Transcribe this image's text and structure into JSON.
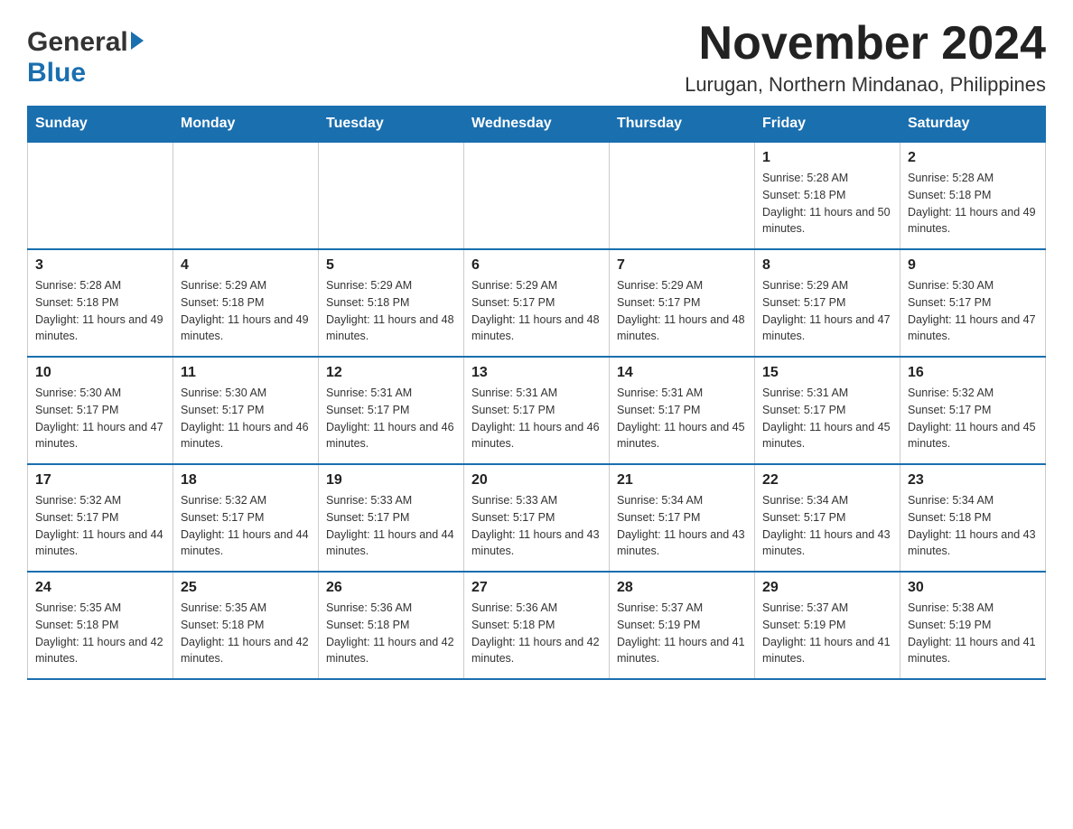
{
  "header": {
    "logo_line1": "General",
    "logo_line2": "Blue",
    "title": "November 2024",
    "subtitle": "Lurugan, Northern Mindanao, Philippines"
  },
  "days_of_week": [
    "Sunday",
    "Monday",
    "Tuesday",
    "Wednesday",
    "Thursday",
    "Friday",
    "Saturday"
  ],
  "weeks": [
    {
      "days": [
        {
          "num": "",
          "sunrise": "",
          "sunset": "",
          "daylight": ""
        },
        {
          "num": "",
          "sunrise": "",
          "sunset": "",
          "daylight": ""
        },
        {
          "num": "",
          "sunrise": "",
          "sunset": "",
          "daylight": ""
        },
        {
          "num": "",
          "sunrise": "",
          "sunset": "",
          "daylight": ""
        },
        {
          "num": "",
          "sunrise": "",
          "sunset": "",
          "daylight": ""
        },
        {
          "num": "1",
          "sunrise": "Sunrise: 5:28 AM",
          "sunset": "Sunset: 5:18 PM",
          "daylight": "Daylight: 11 hours and 50 minutes."
        },
        {
          "num": "2",
          "sunrise": "Sunrise: 5:28 AM",
          "sunset": "Sunset: 5:18 PM",
          "daylight": "Daylight: 11 hours and 49 minutes."
        }
      ]
    },
    {
      "days": [
        {
          "num": "3",
          "sunrise": "Sunrise: 5:28 AM",
          "sunset": "Sunset: 5:18 PM",
          "daylight": "Daylight: 11 hours and 49 minutes."
        },
        {
          "num": "4",
          "sunrise": "Sunrise: 5:29 AM",
          "sunset": "Sunset: 5:18 PM",
          "daylight": "Daylight: 11 hours and 49 minutes."
        },
        {
          "num": "5",
          "sunrise": "Sunrise: 5:29 AM",
          "sunset": "Sunset: 5:18 PM",
          "daylight": "Daylight: 11 hours and 48 minutes."
        },
        {
          "num": "6",
          "sunrise": "Sunrise: 5:29 AM",
          "sunset": "Sunset: 5:17 PM",
          "daylight": "Daylight: 11 hours and 48 minutes."
        },
        {
          "num": "7",
          "sunrise": "Sunrise: 5:29 AM",
          "sunset": "Sunset: 5:17 PM",
          "daylight": "Daylight: 11 hours and 48 minutes."
        },
        {
          "num": "8",
          "sunrise": "Sunrise: 5:29 AM",
          "sunset": "Sunset: 5:17 PM",
          "daylight": "Daylight: 11 hours and 47 minutes."
        },
        {
          "num": "9",
          "sunrise": "Sunrise: 5:30 AM",
          "sunset": "Sunset: 5:17 PM",
          "daylight": "Daylight: 11 hours and 47 minutes."
        }
      ]
    },
    {
      "days": [
        {
          "num": "10",
          "sunrise": "Sunrise: 5:30 AM",
          "sunset": "Sunset: 5:17 PM",
          "daylight": "Daylight: 11 hours and 47 minutes."
        },
        {
          "num": "11",
          "sunrise": "Sunrise: 5:30 AM",
          "sunset": "Sunset: 5:17 PM",
          "daylight": "Daylight: 11 hours and 46 minutes."
        },
        {
          "num": "12",
          "sunrise": "Sunrise: 5:31 AM",
          "sunset": "Sunset: 5:17 PM",
          "daylight": "Daylight: 11 hours and 46 minutes."
        },
        {
          "num": "13",
          "sunrise": "Sunrise: 5:31 AM",
          "sunset": "Sunset: 5:17 PM",
          "daylight": "Daylight: 11 hours and 46 minutes."
        },
        {
          "num": "14",
          "sunrise": "Sunrise: 5:31 AM",
          "sunset": "Sunset: 5:17 PM",
          "daylight": "Daylight: 11 hours and 45 minutes."
        },
        {
          "num": "15",
          "sunrise": "Sunrise: 5:31 AM",
          "sunset": "Sunset: 5:17 PM",
          "daylight": "Daylight: 11 hours and 45 minutes."
        },
        {
          "num": "16",
          "sunrise": "Sunrise: 5:32 AM",
          "sunset": "Sunset: 5:17 PM",
          "daylight": "Daylight: 11 hours and 45 minutes."
        }
      ]
    },
    {
      "days": [
        {
          "num": "17",
          "sunrise": "Sunrise: 5:32 AM",
          "sunset": "Sunset: 5:17 PM",
          "daylight": "Daylight: 11 hours and 44 minutes."
        },
        {
          "num": "18",
          "sunrise": "Sunrise: 5:32 AM",
          "sunset": "Sunset: 5:17 PM",
          "daylight": "Daylight: 11 hours and 44 minutes."
        },
        {
          "num": "19",
          "sunrise": "Sunrise: 5:33 AM",
          "sunset": "Sunset: 5:17 PM",
          "daylight": "Daylight: 11 hours and 44 minutes."
        },
        {
          "num": "20",
          "sunrise": "Sunrise: 5:33 AM",
          "sunset": "Sunset: 5:17 PM",
          "daylight": "Daylight: 11 hours and 43 minutes."
        },
        {
          "num": "21",
          "sunrise": "Sunrise: 5:34 AM",
          "sunset": "Sunset: 5:17 PM",
          "daylight": "Daylight: 11 hours and 43 minutes."
        },
        {
          "num": "22",
          "sunrise": "Sunrise: 5:34 AM",
          "sunset": "Sunset: 5:17 PM",
          "daylight": "Daylight: 11 hours and 43 minutes."
        },
        {
          "num": "23",
          "sunrise": "Sunrise: 5:34 AM",
          "sunset": "Sunset: 5:18 PM",
          "daylight": "Daylight: 11 hours and 43 minutes."
        }
      ]
    },
    {
      "days": [
        {
          "num": "24",
          "sunrise": "Sunrise: 5:35 AM",
          "sunset": "Sunset: 5:18 PM",
          "daylight": "Daylight: 11 hours and 42 minutes."
        },
        {
          "num": "25",
          "sunrise": "Sunrise: 5:35 AM",
          "sunset": "Sunset: 5:18 PM",
          "daylight": "Daylight: 11 hours and 42 minutes."
        },
        {
          "num": "26",
          "sunrise": "Sunrise: 5:36 AM",
          "sunset": "Sunset: 5:18 PM",
          "daylight": "Daylight: 11 hours and 42 minutes."
        },
        {
          "num": "27",
          "sunrise": "Sunrise: 5:36 AM",
          "sunset": "Sunset: 5:18 PM",
          "daylight": "Daylight: 11 hours and 42 minutes."
        },
        {
          "num": "28",
          "sunrise": "Sunrise: 5:37 AM",
          "sunset": "Sunset: 5:19 PM",
          "daylight": "Daylight: 11 hours and 41 minutes."
        },
        {
          "num": "29",
          "sunrise": "Sunrise: 5:37 AM",
          "sunset": "Sunset: 5:19 PM",
          "daylight": "Daylight: 11 hours and 41 minutes."
        },
        {
          "num": "30",
          "sunrise": "Sunrise: 5:38 AM",
          "sunset": "Sunset: 5:19 PM",
          "daylight": "Daylight: 11 hours and 41 minutes."
        }
      ]
    }
  ]
}
